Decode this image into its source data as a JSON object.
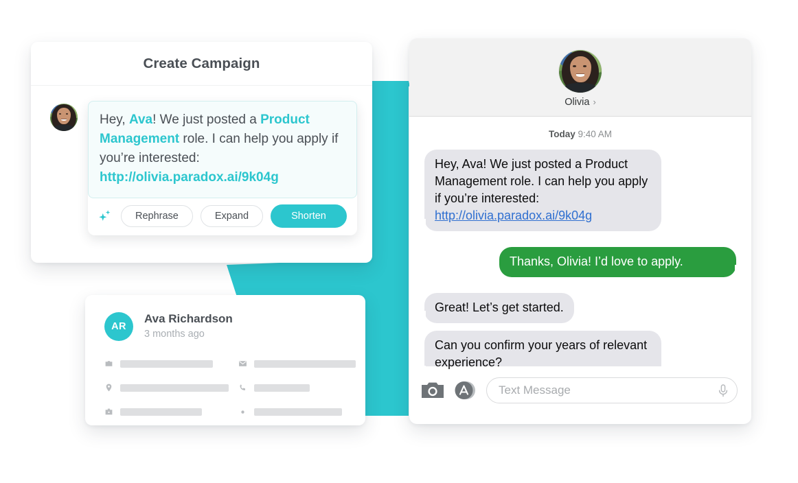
{
  "theme": {
    "teal": "#2CC6CE",
    "green_bubble": "#2A9D3F",
    "grey_bubble": "#E5E5EA",
    "link_blue": "#2F6FD0",
    "text_dark": "#4A4F55"
  },
  "campaign_card": {
    "title": "Create Campaign",
    "avatar_name": "olivia-avatar",
    "message": {
      "part1": "Hey, ",
      "name": "Ava",
      "part2": "! We just posted a ",
      "role": "Product Management",
      "part3": " role. I can help you apply if you’re interested: ",
      "link": "http://olivia.paradox.ai/9k04g"
    },
    "actions": {
      "sparkle_icon": "ai-sparkle-icon",
      "rephrase_label": "Rephrase",
      "expand_label": "Expand",
      "shorten_label": "Shorten"
    }
  },
  "profile_card": {
    "initials": "AR",
    "name": "Ava Richardson",
    "subtitle": "3 months ago",
    "fields": [
      {
        "icon": "briefcase-icon",
        "redacted_width": 135
      },
      {
        "icon": "envelope-icon",
        "redacted_width": 148
      },
      {
        "icon": "location-pin-icon",
        "redacted_width": 158
      },
      {
        "icon": "phone-icon",
        "redacted_width": 81
      },
      {
        "icon": "suitcase-icon",
        "redacted_width": 119
      },
      {
        "icon": "dot-icon",
        "redacted_width": 128
      }
    ]
  },
  "messages_card": {
    "header": {
      "avatar_name": "olivia-avatar",
      "contact_name": "Olivia",
      "chevron": "›"
    },
    "timestamp": {
      "day": "Today",
      "time": "9:40 AM"
    },
    "thread": [
      {
        "side": "in",
        "text_before_link": "Hey, Ava! We just posted a Product Management role. I can help you apply if you’re interested: ",
        "link": "http://olivia.paradox.ai/9k04g"
      },
      {
        "side": "out",
        "text": "Thanks, Olivia! I’d love to apply."
      },
      {
        "side": "in",
        "text": "Great! Let’s get started."
      },
      {
        "side": "in",
        "text": "Can you confirm your years of relevant experience?"
      }
    ],
    "input_bar": {
      "camera_icon": "camera-icon",
      "appstore_icon": "app-store-icon",
      "placeholder": "Text Message",
      "mic_icon": "microphone-icon"
    }
  }
}
